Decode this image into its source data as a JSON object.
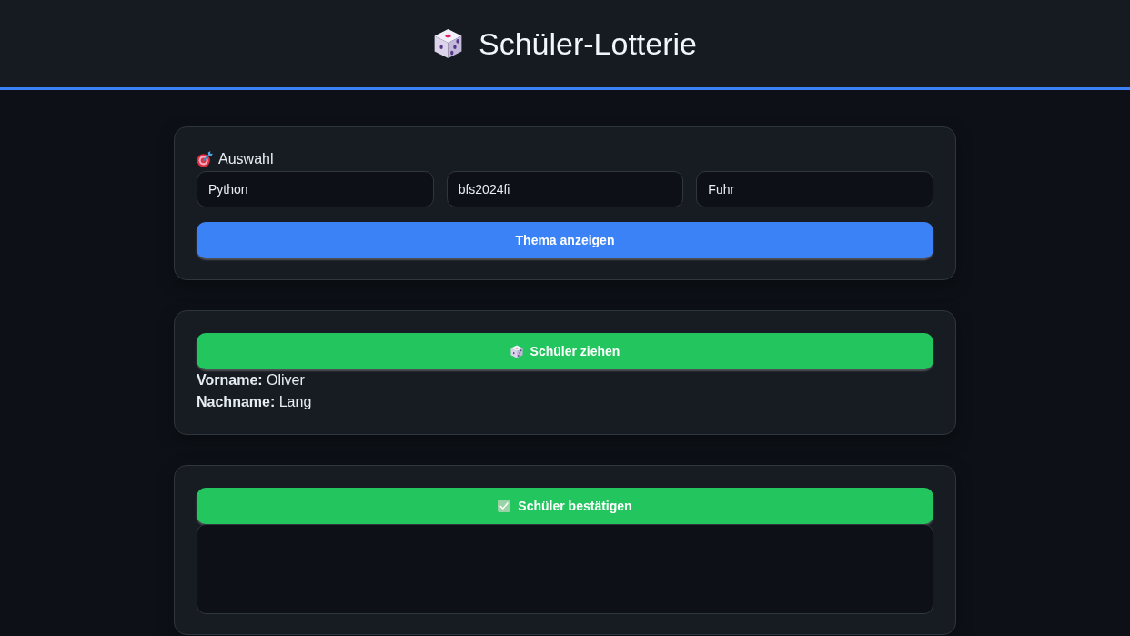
{
  "header": {
    "title": "Schüler-Lotterie"
  },
  "selection": {
    "label": "Auswahl",
    "fields": [
      {
        "value": "Python"
      },
      {
        "value": "bfs2024fi"
      },
      {
        "value": "Fuhr"
      }
    ],
    "button": "Thema anzeigen"
  },
  "draw": {
    "button": "Schüler ziehen",
    "result_lines": [
      "**Vorname:** Oliver",
      "**Nachname:** Lang"
    ]
  },
  "confirm": {
    "button": "Schüler bestätigen"
  }
}
